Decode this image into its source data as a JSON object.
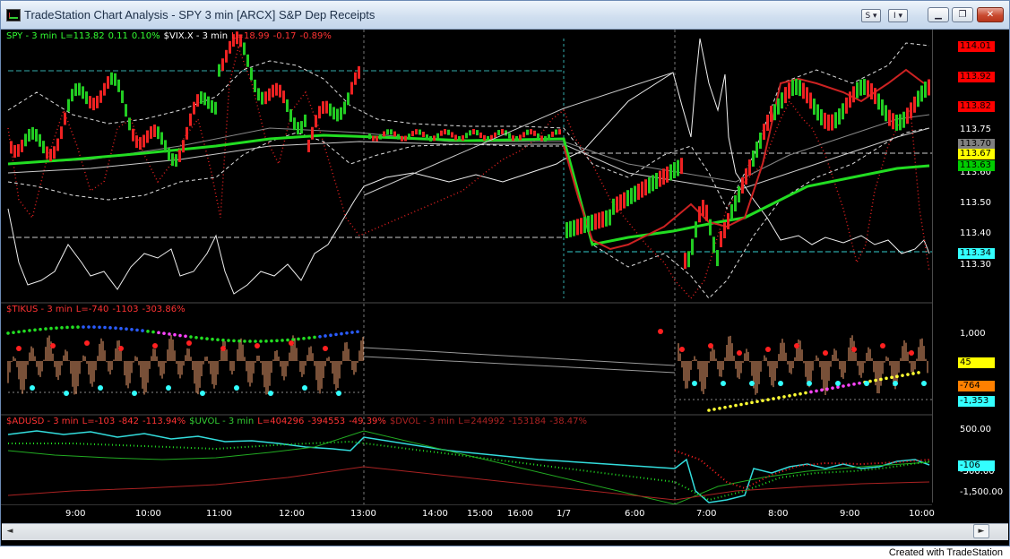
{
  "window": {
    "title": "TradeStation Chart Analysis - SPY 3 min [ARCX] S&P Dep Receipts",
    "buttons": {
      "s": "S",
      "i": "I",
      "minimize": "▁",
      "restore": "❐",
      "close": "✕"
    }
  },
  "panes": {
    "price": {
      "legend": [
        {
          "text": "SPY - 3 min",
          "color": "#33ff33"
        },
        {
          "text": "L=113.82",
          "color": "#33ff33"
        },
        {
          "text": "0.11",
          "color": "#33ff33"
        },
        {
          "text": "0.10%",
          "color": "#33ff33"
        },
        {
          "text": "$VIX.X - 3 min",
          "color": "#ffffff"
        },
        {
          "text": "L=18.99",
          "color": "#ff3333"
        },
        {
          "text": "-0.17",
          "color": "#ff3333"
        },
        {
          "text": "-0.89%",
          "color": "#ff3333"
        }
      ],
      "ticks": [
        "113.60",
        "113.50",
        "113.40",
        "113.30"
      ],
      "tags": [
        {
          "text": "114.01",
          "bg": "#ff0000",
          "fg": "#000000"
        },
        {
          "text": "113.92",
          "bg": "#ff0000",
          "fg": "#000000"
        },
        {
          "text": "113.82",
          "bg": "#ff0000",
          "fg": "#000000"
        },
        {
          "text": "113.75",
          "bg": "#000000",
          "fg": "#ffffff"
        },
        {
          "text": "113.70",
          "bg": "#808080",
          "fg": "#000000"
        },
        {
          "text": "113.67",
          "bg": "#ffff00",
          "fg": "#000000"
        },
        {
          "text": "113.63",
          "bg": "#00cc00",
          "fg": "#000000"
        },
        {
          "text": "113.34",
          "bg": "#33ffff",
          "fg": "#000000"
        }
      ]
    },
    "tikus": {
      "legend": [
        {
          "text": "$TIKUS - 3 min",
          "color": "#ff3333"
        },
        {
          "text": "L=-740",
          "color": "#ff3333"
        },
        {
          "text": "-1103",
          "color": "#ff3333"
        },
        {
          "text": "-303.86%",
          "color": "#ff3333"
        }
      ],
      "ticks": [
        "1,000"
      ],
      "tags": [
        {
          "text": "45",
          "bg": "#ffff00",
          "fg": "#000000"
        },
        {
          "text": "-764",
          "bg": "#ff8000",
          "fg": "#000000"
        },
        {
          "text": "-1,353",
          "bg": "#33ffff",
          "fg": "#000000"
        }
      ]
    },
    "adusd": {
      "legend": [
        {
          "text": "$ADUSD - 3 min",
          "color": "#ff3333"
        },
        {
          "text": "L=-103",
          "color": "#ff3333"
        },
        {
          "text": "-842",
          "color": "#ff3333"
        },
        {
          "text": "-113.94%",
          "color": "#ff3333"
        },
        {
          "text": "$UVOL - 3 min",
          "color": "#33cc33"
        },
        {
          "text": "L=404296",
          "color": "#ff3333"
        },
        {
          "text": "-394553",
          "color": "#ff3333"
        },
        {
          "text": "-49.39%",
          "color": "#ff3333"
        },
        {
          "text": "$DVOL - 3 min",
          "color": "#aa2222"
        },
        {
          "text": "L=244992",
          "color": "#aa2222"
        },
        {
          "text": "-153184",
          "color": "#aa2222"
        },
        {
          "text": "-38.47%",
          "color": "#aa2222"
        }
      ],
      "ticks": [
        "500.00",
        "-500.00",
        "-1,500.00"
      ],
      "tags": [
        {
          "text": "-106",
          "bg": "#33ffff",
          "fg": "#000000"
        }
      ]
    }
  },
  "xaxis": {
    "labels": [
      "9:00",
      "10:00",
      "11:00",
      "12:00",
      "13:00",
      "14:00",
      "15:00",
      "16:00",
      "1/7",
      "6:00",
      "7:00",
      "8:00",
      "9:00",
      "10:00"
    ]
  },
  "scrollbar": {
    "left": "◄",
    "right": "►"
  },
  "footer": "Created with TradeStation"
}
